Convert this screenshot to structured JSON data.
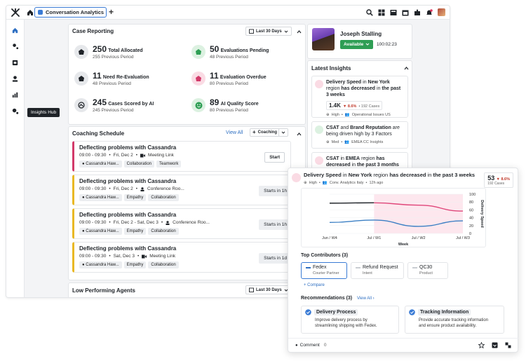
{
  "topbar": {
    "tab_label": "Conversation Analytics"
  },
  "sidebar": {
    "tooltip": "Insights Hub"
  },
  "case_reporting": {
    "title": "Case Reporting",
    "date_range": "Last 30 Days",
    "metrics": [
      {
        "value": "250",
        "label": "Total Allocated",
        "prev": "255 Previous Period"
      },
      {
        "value": "50",
        "label": "Evaluations Pending",
        "prev": "48 Previous Period"
      },
      {
        "value": "11",
        "label": "Need Re-Evaluation",
        "prev": "48 Previous Period"
      },
      {
        "value": "11",
        "label": "Evaluation Overdue",
        "prev": "80 Previous Period"
      },
      {
        "value": "245",
        "label": "Cases Scored by AI",
        "prev": "245 Previous Period"
      },
      {
        "value": "89",
        "label": "AI Quality Score",
        "prev": "80 Previous Period"
      }
    ]
  },
  "coaching": {
    "title": "Coaching Schedule",
    "view_all": "View All",
    "add_label": "Coaching",
    "items": [
      {
        "title": "Deflecting problems with Cassandra",
        "time": "09:00 - 09:30",
        "date": "Fri, Dec 2",
        "location": "Meeting Link",
        "person": "Cassandra Haw...",
        "tags": [
          "Collaboration",
          "Teamwork"
        ],
        "action": "Start"
      },
      {
        "title": "Deflecting problems with Cassandra",
        "time": "09:00 - 09:30",
        "date": "Fri, Dec 2",
        "location": "Conference Roo...",
        "person": "Cassandra Haw...",
        "tags": [
          "Empathy",
          "Collaboration"
        ],
        "action": "Starts in 1h"
      },
      {
        "title": "Deflecting problems with Cassandra",
        "time": "09:00 - 09:30",
        "date": "Fri, Dec 2 - Sat, Dec 3",
        "location": "Conference Roo...",
        "person": "Cassandra Haw...",
        "tags": [
          "Empathy",
          "Collaboration"
        ],
        "action": "Starts in 1h"
      },
      {
        "title": "Deflecting problems with Cassandra",
        "time": "09:00 - 09:30",
        "date": "Sat, Dec 3",
        "location": "Meeting Link",
        "person": "Cassandra Haw...",
        "tags": [
          "Empathy",
          "Collaboration"
        ],
        "action": "Starts in 1d"
      }
    ]
  },
  "low_performing": {
    "title": "Low Performing Agents",
    "date_range": "Last 30 Days"
  },
  "agent": {
    "name": "Joseph Stalling",
    "status": "Available",
    "timer": "100:02:23"
  },
  "latest_insights": {
    "title": "Latest Insights",
    "items": [
      {
        "p1": "Delivery Speed",
        "p2": " in ",
        "p3": "New York",
        "p4": " region ",
        "p5": "has decreased",
        "p6": " in ",
        "p7": "the past 3 weeks",
        "kpi": "1.4K",
        "delta": "8.6%",
        "cases": "192 Cases",
        "priority": "High",
        "source": "Operational Issues US"
      },
      {
        "p1": "CSAT",
        "p2": " and ",
        "p3": "Brand Reputation",
        "p4": " are being driven high by 3 Factors",
        "priority": "Med",
        "source": "EMEA CC Insights"
      },
      {
        "p1": "CSAT",
        "p2": " in ",
        "p3": "EMEA",
        "p4": " region ",
        "p5": "has decreased",
        "p6": " in ",
        "p7": "the past 3 months"
      }
    ]
  },
  "detail": {
    "t1": "Delivery Speed",
    "t2": " in ",
    "t3": "New York",
    "t4": " region ",
    "t5": "has decreased",
    "t6": " in ",
    "t7": "the past 3 weeks",
    "priority": "High",
    "source": "Conv. Analytics Italy",
    "age": "12h ago",
    "count": "53",
    "delta": "8.6%",
    "cases": "192 Cases",
    "contributors_title": "Top Contributors (3)",
    "contributors": [
      {
        "name": "Fedex",
        "sub": "Courier Partner"
      },
      {
        "name": "Refund Request",
        "sub": "Intent"
      },
      {
        "name": "QC30",
        "sub": "Product"
      }
    ],
    "compare": "Compare",
    "recs_title": "Recommendations (3)",
    "recs_view_all": "View All",
    "recs": [
      {
        "title": "Delivery Process",
        "desc1": "Improve delivery process by",
        "desc2": "streamlining shipping with Fedex."
      },
      {
        "title": "Tracking Information",
        "desc1": "Provide accurate tracking information",
        "desc2": "and ensure product availability."
      }
    ],
    "comment_label": "Comment",
    "comment_count": "0"
  },
  "chart_data": {
    "type": "line",
    "categories": [
      "Jun / W4",
      "Jul / W1",
      "Jul / W2",
      "Jul / W3"
    ],
    "xlabel": "Week",
    "ylabel": "Delivery Speed",
    "ylim": [
      0,
      100
    ],
    "yticks": [
      "0",
      "20",
      "40",
      "60",
      "80",
      "100"
    ],
    "series": [
      {
        "color": "#1f2328",
        "values": [
          77,
          78,
          null,
          null
        ]
      },
      {
        "color": "#e0467a",
        "values": [
          null,
          78,
          72,
          57
        ]
      },
      {
        "color": "#3b7fc4",
        "values": [
          28,
          34,
          18,
          32
        ]
      }
    ],
    "highlight_range": [
      "Jul / W1",
      "Jul / W3"
    ]
  }
}
